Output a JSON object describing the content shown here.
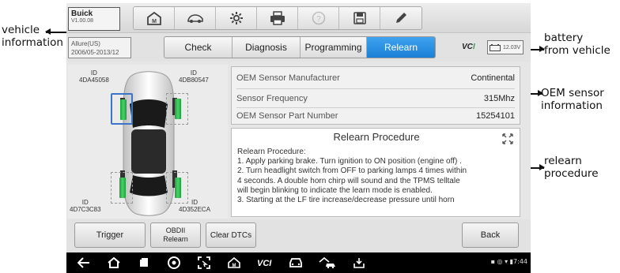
{
  "annotations": {
    "vehicle_info": [
      "vehicle",
      "information"
    ],
    "battery": [
      "battery",
      "from vehicle"
    ],
    "oem": [
      "OEM sensor",
      "information"
    ],
    "relearn": [
      "relearn",
      "procedure"
    ]
  },
  "header": {
    "vehicle_make": "Buick",
    "version": "V1.00.08",
    "vehicle_model": "Allure(US)",
    "vehicle_years": "2006/05-2013/12"
  },
  "toolbar": {
    "icons": [
      "home-icon",
      "vehicle-swap-icon",
      "settings-icon",
      "print-icon",
      "help-icon",
      "save-icon",
      "pen-icon"
    ]
  },
  "tabs": [
    {
      "label": "Check",
      "active": false
    },
    {
      "label": "Diagnosis",
      "active": false
    },
    {
      "label": "Programming",
      "active": false
    },
    {
      "label": "Relearn",
      "active": true
    }
  ],
  "vci": {
    "label": "VCI",
    "battery_voltage": "12.03V"
  },
  "sensors": {
    "front_left": {
      "label": "ID",
      "id": "4DA45058"
    },
    "front_right": {
      "label": "ID",
      "id": "4DB80547"
    },
    "rear_left": {
      "label": "ID",
      "id": "4D7C3C83"
    },
    "rear_right": {
      "label": "ID",
      "id": "4D352ECA"
    }
  },
  "oem_info": {
    "rows": [
      {
        "label": "OEM Sensor Manufacturer",
        "value": "Continental"
      },
      {
        "label": "Sensor Frequency",
        "value": "315Mhz"
      },
      {
        "label": "OEM Sensor Part Number",
        "value": "15254101"
      }
    ]
  },
  "relearn": {
    "title": "Relearn Procedure",
    "lines": [
      "Relearn Procedure:",
      "1. Apply parking brake. Turn ignition to ON position (engine off) .",
      "2. Turn headlight switch from OFF to parking lamps 4 times within",
      "4 seconds. A double horn chirp will sound and the TPMS telltale",
      "will begin blinking to indicate the learn mode is enabled.",
      "3. Starting at the LF tire increase/decrease pressure until horn"
    ]
  },
  "buttons": {
    "trigger": "Trigger",
    "obdii_relearn_1": "OBDII",
    "obdii_relearn_2": "Relearn",
    "clear_dtcs": "Clear DTCs",
    "back": "Back"
  },
  "navbar": {
    "icons": [
      "back-icon",
      "home-icon",
      "recents-icon",
      "chrome-icon",
      "screenshot-icon",
      "house-icon",
      "vci-icon",
      "car-icon",
      "garage-icon",
      "update-icon"
    ],
    "time": "7:44"
  },
  "colors": {
    "accent": "#1b7fd6",
    "sensor_ok": "#2fbf52",
    "selection": "#3b74c9"
  }
}
